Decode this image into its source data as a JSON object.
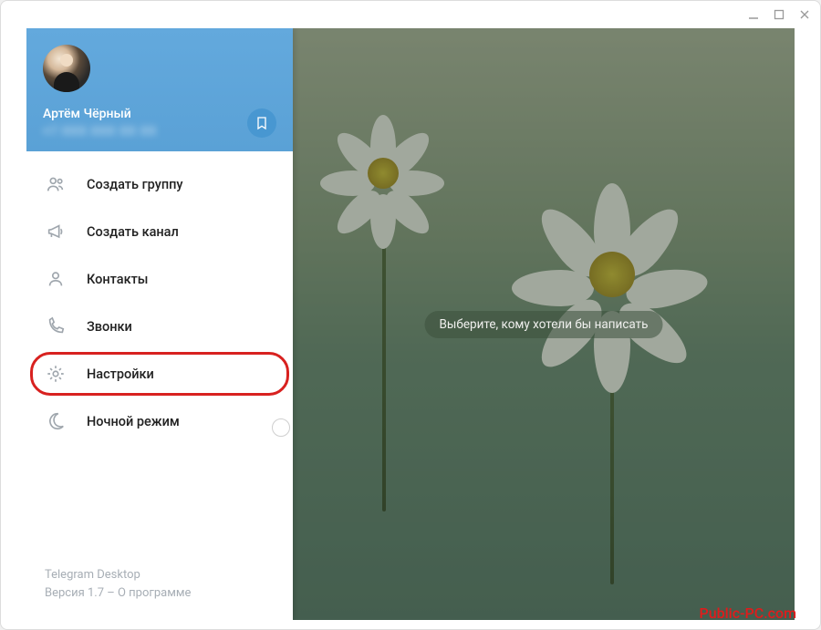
{
  "window": {
    "app_name": "Telegram Desktop"
  },
  "user": {
    "name": "Артём Чёрный",
    "phone_masked": "+7 XXX XXX XX XX"
  },
  "menu": {
    "items": [
      {
        "icon": "group-icon",
        "label": "Создать группу"
      },
      {
        "icon": "megaphone-icon",
        "label": "Создать канал"
      },
      {
        "icon": "person-icon",
        "label": "Контакты"
      },
      {
        "icon": "phone-icon",
        "label": "Звонки"
      },
      {
        "icon": "gear-icon",
        "label": "Настройки",
        "highlighted": true
      },
      {
        "icon": "moon-icon",
        "label": "Ночной режим",
        "has_toggle": true,
        "toggle_on": false
      }
    ]
  },
  "footer": {
    "app_label": "Telegram Desktop",
    "version_line": "Версия 1.7 – О программе"
  },
  "main": {
    "placeholder": "Выберите, кому хотели бы написать"
  },
  "watermark": "Public-PC.com"
}
